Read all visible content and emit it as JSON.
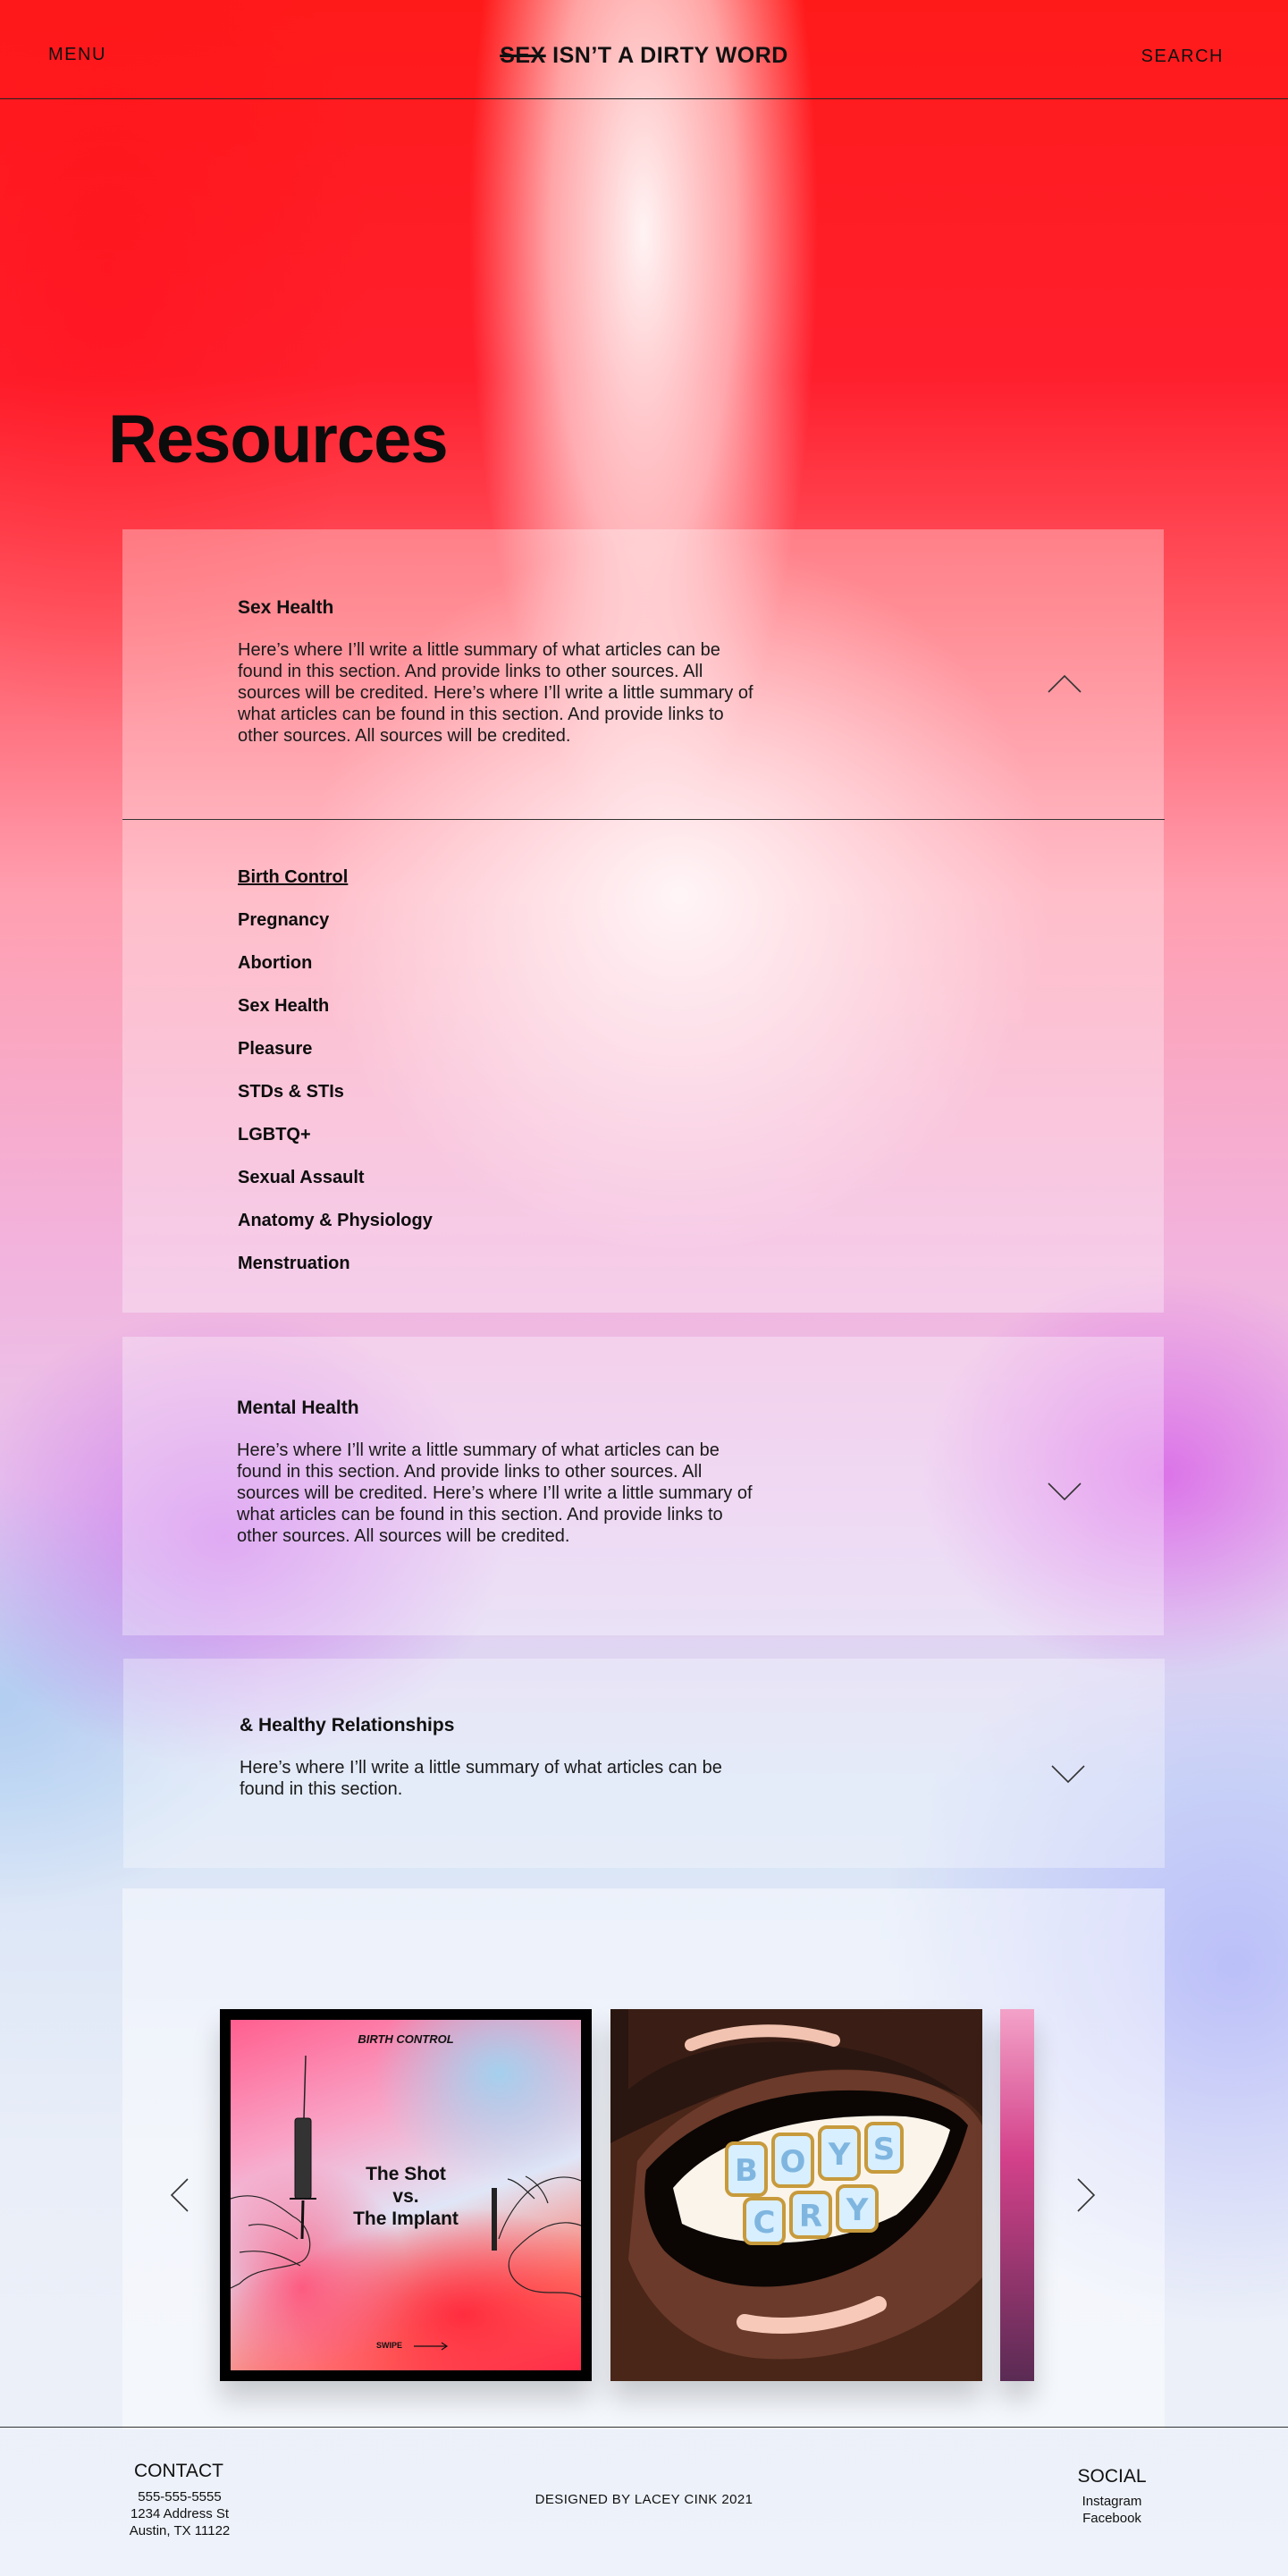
{
  "header": {
    "menu_label": "MENU",
    "brand_struck": "SEX",
    "brand_rest": "ISN’T A DIRTY WORD",
    "search_label": "SEARCH"
  },
  "page_title": "Resources",
  "sections": [
    {
      "title": "Sex Health",
      "description": "Here’s where I’ll write a little summary of what articles can be found in this section. And provide links to other sources. All sources will be credited. Here’s where I’ll write a little summary of what articles can be found in this section. And provide links to other sources. All sources will be credited.",
      "expanded": true,
      "icon": "chevron-up-icon",
      "topics": [
        "Birth Control",
        "Pregnancy",
        "Abortion",
        "Sex Health",
        "Pleasure",
        "STDs & STIs",
        "LGBTQ+",
        "Sexual Assault",
        "Anatomy & Physiology",
        "Menstruation"
      ],
      "active_topic": "Birth Control"
    },
    {
      "title": "Mental Health",
      "description": "Here’s where I’ll write a little summary of what articles can be found in this section. And provide links to other sources. All sources will be credited. Here’s where I’ll write a little summary of what articles can be found in this section. And provide links to other sources. All sources will be credited.",
      "expanded": false,
      "icon": "chevron-down-icon"
    },
    {
      "title": "& Healthy Relationships",
      "description": "Here’s where I’ll write a little summary of what articles can be found in this section.",
      "expanded": false,
      "icon": "chevron-down-icon"
    }
  ],
  "carousel": {
    "cards": [
      {
        "kicker": "BIRTH CONTROL",
        "title_line1": "The Shot",
        "title_line2": "vs.",
        "title_line3": "The Implant",
        "swipe_label": "SWIPE"
      },
      {
        "grill_top": "BOYS",
        "grill_bottom": "CRY"
      }
    ],
    "prev_icon": "chevron-left-icon",
    "next_icon": "chevron-right-icon"
  },
  "footer": {
    "contact_heading": "CONTACT",
    "phone": "555-555-5555",
    "address_line1": "1234 Address St",
    "address_line2": "Austin, TX 11122",
    "credit": "DESIGNED BY LACEY CINK 2021",
    "social_heading": "SOCIAL",
    "social_links": [
      "Instagram",
      "Facebook"
    ]
  },
  "colors": {
    "accent_red": "#ff1a1a",
    "text": "#111111"
  }
}
